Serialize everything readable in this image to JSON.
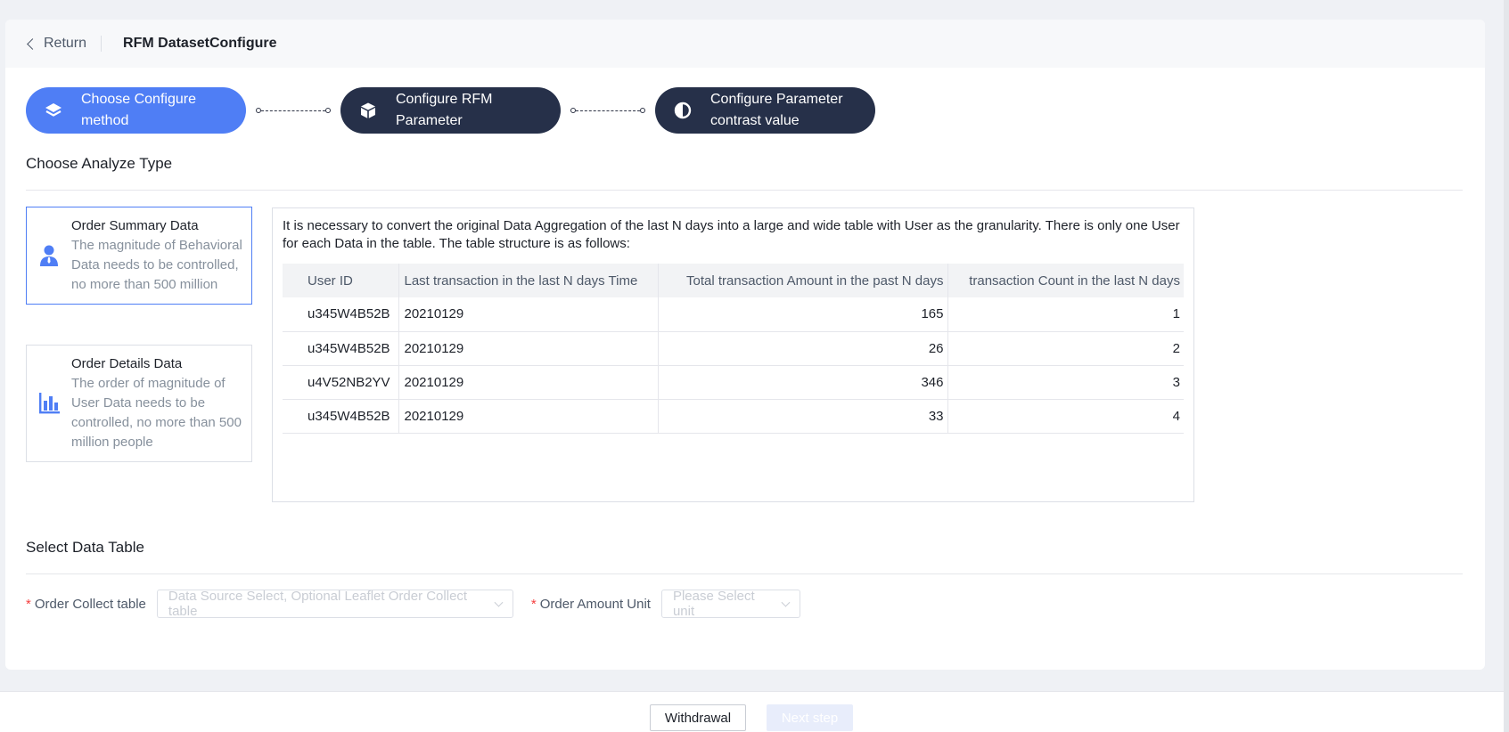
{
  "header": {
    "return_label": "Return",
    "title": "RFM DatasetConfigure"
  },
  "steps": [
    {
      "label_line1": "Choose Configure",
      "label_line2": "method",
      "icon": "layers-icon",
      "state": "active"
    },
    {
      "label_line1": "Configure RFM",
      "label_line2": "Parameter",
      "icon": "cube-icon",
      "state": "inactive"
    },
    {
      "label_line1": "Configure Parameter",
      "label_line2": "contrast value",
      "icon": "contrast-icon",
      "state": "inactive"
    }
  ],
  "analyze": {
    "section_title": "Choose Analyze Type",
    "types": [
      {
        "title": "Order Summary Data",
        "desc": "The magnitude of Behavioral Data needs to be controlled, no more than 500 million",
        "icon": "user-icon",
        "selected": true
      },
      {
        "title": "Order Details Data",
        "desc": "The order of magnitude of User Data needs to be controlled, no more than 500 million people",
        "icon": "bar-chart-icon",
        "selected": false
      }
    ],
    "description": "It is necessary to convert the original Data Aggregation of the last N days into a large and wide table with User as the granularity. There is only one User for each Data in the table. The table structure is as follows:",
    "table": {
      "headers": [
        "User ID",
        "Last transaction in the last N days Time",
        "Total transaction Amount in the past N days",
        "transaction Count in the last N days"
      ],
      "rows": [
        [
          "u345W4B52B",
          "20210129",
          "165",
          "1"
        ],
        [
          "u345W4B52B",
          "20210129",
          "26",
          "2"
        ],
        [
          "u4V52NB2YV",
          "20210129",
          "346",
          "3"
        ],
        [
          "u345W4B52B",
          "20210129",
          "33",
          "4"
        ]
      ]
    }
  },
  "data_table": {
    "section_title": "Select Data Table",
    "order_collect": {
      "label": "Order Collect table",
      "placeholder": "Data Source Select, Optional Leaflet Order Collect table"
    },
    "amount_unit": {
      "label": "Order Amount Unit",
      "placeholder": "Please Select unit"
    }
  },
  "footer": {
    "withdraw_label": "Withdrawal",
    "next_label": "Next step"
  },
  "colors": {
    "primary": "#4f7ef5",
    "dark_step": "#263049",
    "required": "#f53f3f"
  }
}
